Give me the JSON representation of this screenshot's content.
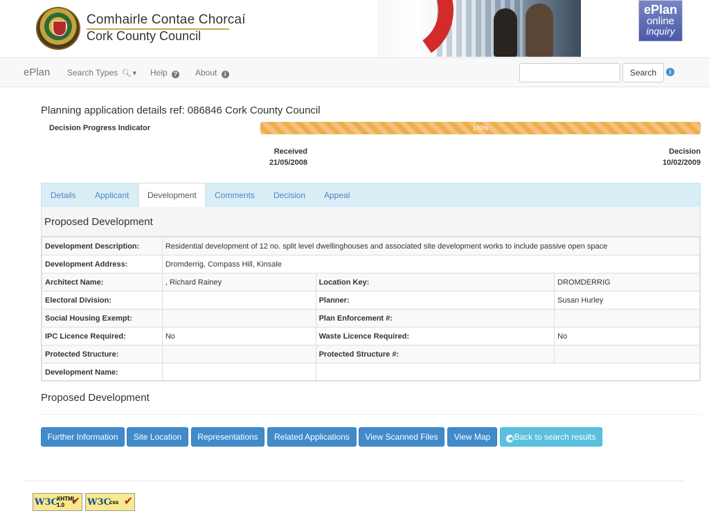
{
  "header": {
    "brand_irish": "Comhairle Contae Chorcaí",
    "brand_english": "Cork County Council",
    "eplan_logo": {
      "line1": "ePlan",
      "line2": "online",
      "line3": "inquiry"
    }
  },
  "navbar": {
    "brand": "ePlan",
    "items": [
      {
        "label": "Search Types",
        "icon": "search-icon"
      },
      {
        "label": "Help",
        "icon": "question-circle-icon"
      },
      {
        "label": "About",
        "icon": "info-circle-icon"
      }
    ],
    "search_value": "",
    "search_button": "Search",
    "info_icon": "i"
  },
  "page": {
    "title": "Planning application details ref: 086846 Cork County Council"
  },
  "progress": {
    "label": "Decision Progress Indicator",
    "percent_text": "100%",
    "percent": 100,
    "received_label": "Received",
    "received_date": "21/05/2008",
    "decision_label": "Decision",
    "decision_date": "10/02/2009",
    "color": "#f0ad4e"
  },
  "tabs": [
    {
      "label": "Details"
    },
    {
      "label": "Applicant"
    },
    {
      "label": "Development"
    },
    {
      "label": "Comments"
    },
    {
      "label": "Decision"
    },
    {
      "label": "Appeal"
    }
  ],
  "active_tab": "Development",
  "panel": {
    "heading": "Proposed Development",
    "development_description_label": "Development Description:",
    "development_description": "Residential development of 12 no. split level dwellinghouses and associated site development works to include passive open space",
    "development_address_label": "Development Address:",
    "development_address": "Dromderrig, Compass Hill, Kinsale",
    "rows": [
      {
        "l1": "Architect Name:",
        "v1": ", Richard Rainey",
        "l2": "Location Key:",
        "v2": "DROMDERRIG"
      },
      {
        "l1": "Electoral Division:",
        "v1": "",
        "l2": "Planner:",
        "v2": "Susan Hurley"
      },
      {
        "l1": "Social Housing Exempt:",
        "v1": "",
        "l2": "Plan Enforcement #:",
        "v2": ""
      },
      {
        "l1": "IPC Licence Required:",
        "v1": "No",
        "l2": "Waste Licence Required:",
        "v2": "No"
      },
      {
        "l1": "Protected Structure:",
        "v1": "",
        "l2": "Protected Structure #:",
        "v2": ""
      }
    ],
    "development_name_label": "Development Name:",
    "development_name": ""
  },
  "section_title": "Proposed Development",
  "buttons": [
    "Further Information",
    "Site Location",
    "Representations",
    "Related Applications",
    "View Scanned Files",
    "View Map"
  ],
  "back_button": "Back to search results",
  "footer": {
    "badge1": {
      "w3": "W3C",
      "tag1": "XHTML",
      "tag2": "1.0"
    },
    "badge2": {
      "w3": "W3C",
      "tag1": "css",
      "tag2": ""
    }
  }
}
